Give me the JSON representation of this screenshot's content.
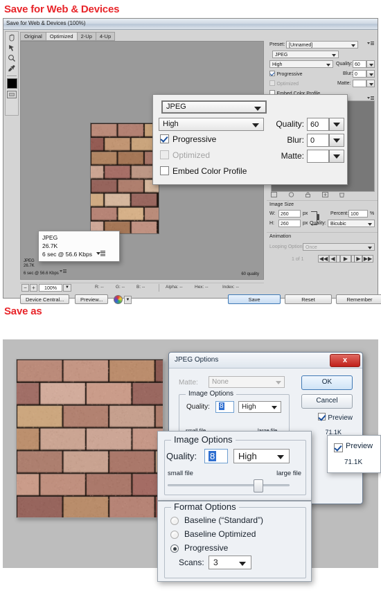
{
  "headings": {
    "save_for_web": "Save for Web & Devices",
    "save_as": "Save as"
  },
  "save_for_web_window": {
    "title": "Save for Web & Devices (100%)",
    "tabs": [
      "Original",
      "Optimized",
      "2-Up",
      "4-Up"
    ],
    "active_tab": "Optimized",
    "toolbox_icons": [
      "hand-icon",
      "slice-select-icon",
      "zoom-icon",
      "eyedropper-icon",
      "foreground-color-swatch",
      "slice-visibility-icon"
    ],
    "canvas": {
      "annotation_lines": [
        "JPEG",
        "26.7K",
        "6 sec @ 56.6 Kbps"
      ],
      "quality_note": "60 quality"
    },
    "status_bar": {
      "zoom": "100%",
      "r": "R: --",
      "g": "G: --",
      "b": "B: --",
      "alpha": "Alpha: --",
      "hex": "Hex: --",
      "index": "Index: --"
    },
    "footer": {
      "device_central": "Device Central...",
      "preview": "Preview...",
      "save": "Save",
      "reset": "Reset",
      "remember": "Remember"
    },
    "settings": {
      "preset_label": "Preset:",
      "preset_value": "[Unnamed]",
      "format": "JPEG",
      "compression": "High",
      "quality_label": "Quality:",
      "quality_value": "60",
      "blur_label": "Blur:",
      "blur_value": "0",
      "matte_label": "Matte:",
      "matte_value": "",
      "progressive": "Progressive",
      "progressive_checked": true,
      "optimized": "Optimized",
      "optimized_checked": false,
      "optimized_disabled": true,
      "embed_color_profile": "Embed Color Profile",
      "embed_checked": false
    },
    "image_size": {
      "group": "Image Size",
      "w_label": "W:",
      "w_value": "260",
      "w_unit": "px",
      "h_label": "H:",
      "h_value": "260",
      "h_unit": "px",
      "percent_label": "Percent:",
      "percent_value": "100",
      "percent_unit": "%",
      "quality_label": "Quality:",
      "quality_value": "Bicubic"
    },
    "animation": {
      "group": "Animation",
      "looping_label": "Looping Options:",
      "looping_value": "Once",
      "frame_counter": "1 of 1"
    }
  },
  "zoom_settings_overlay": {
    "format": "JPEG",
    "compression": "High",
    "quality_label": "Quality:",
    "quality_value": "60",
    "blur_label": "Blur:",
    "blur_value": "0",
    "matte_label": "Matte:",
    "matte_value": "",
    "progressive": "Progressive",
    "optimized": "Optimized",
    "embed_color_profile": "Embed Color Profile"
  },
  "zoom_info_overlay": {
    "line1": "JPEG",
    "line2": "26.7K",
    "line3": "6 sec @ 56.6 Kbps"
  },
  "jpeg_options_dialog": {
    "title": "JPEG Options",
    "close": "x",
    "matte_label": "Matte:",
    "matte_value": "None",
    "image_options_group": "Image Options",
    "quality_label": "Quality:",
    "quality_value": "8",
    "quality_preset": "High",
    "small_file": "small file",
    "large_file": "large file",
    "ok": "OK",
    "cancel": "Cancel",
    "preview": "Preview",
    "file_size": "71.1K"
  },
  "zoom_image_options_overlay": {
    "group": "Image Options",
    "quality_label": "Quality:",
    "quality_value": "8",
    "quality_preset": "High",
    "small_file": "small file",
    "large_file": "large file"
  },
  "zoom_format_options_overlay": {
    "group": "Format Options",
    "options": [
      {
        "label": "Baseline (“Standard”)",
        "selected": false
      },
      {
        "label": "Baseline Optimized",
        "selected": false
      },
      {
        "label": "Progressive",
        "selected": true
      }
    ],
    "scans_label": "Scans:",
    "scans_value": "3"
  },
  "zoom_preview_overlay": {
    "preview": "Preview",
    "file_size": "71.1K"
  },
  "colors": {
    "heading_red": "#e8252a",
    "accent_blue": "#2f6fd0",
    "close_red": "#c0201a"
  }
}
